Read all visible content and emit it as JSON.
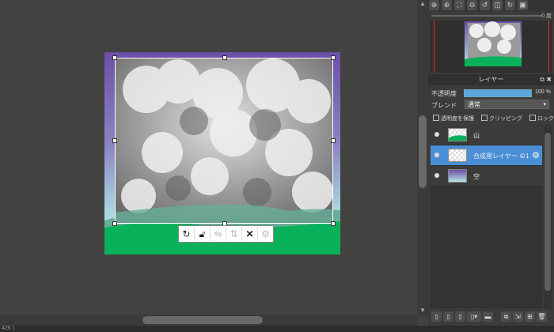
{
  "statusbar": {
    "text": "426 )"
  },
  "navigator": {
    "tools": [
      "zoom-in-icon",
      "zoom-in-alt-icon",
      "fit-icon",
      "zoom-out-icon",
      "rotate-left-icon",
      "flip-icon",
      "rotate-right-icon",
      "pin-icon"
    ],
    "angle_value": "0 度"
  },
  "layer_panel": {
    "title": "レイヤー",
    "opacity_label": "不透明度",
    "opacity_value": "100 %",
    "opacity": 1.0,
    "blend_label": "ブレンド",
    "blend_value": "通常",
    "checks": [
      "透明度を保護",
      "クリッピング",
      "ロック"
    ],
    "layers": [
      {
        "name": "山",
        "active": false,
        "visible": true
      },
      {
        "name": "合成用レイヤー ⊕1",
        "active": true,
        "visible": true
      },
      {
        "name": "空",
        "active": false,
        "visible": true
      }
    ]
  },
  "transform_toolbar": [
    "rotate-icon",
    "lock-icon",
    "flip-horizontal-icon",
    "flip-vertical-icon",
    "close-icon",
    "settings-icon"
  ],
  "colors": {
    "accent": "#4a8fd6",
    "sky_top": "#6e4fa8",
    "ground": "#09b25a",
    "hill": "#67ae98"
  }
}
